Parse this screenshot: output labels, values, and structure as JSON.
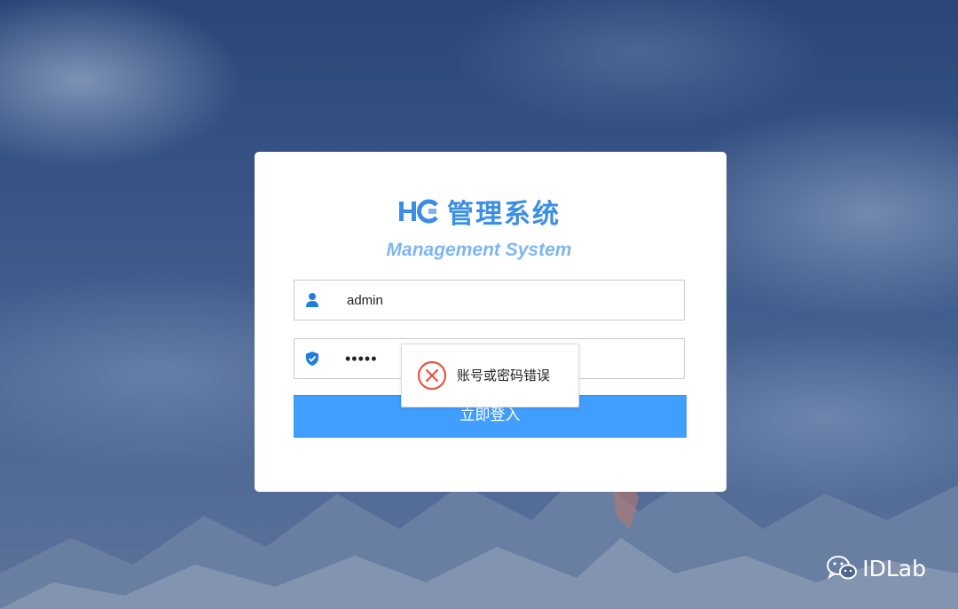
{
  "brand": {
    "title": "HC 管理系统",
    "logo_text": "HC",
    "name": "管理系统",
    "subtitle": "Management System",
    "color": "#3a8ee6"
  },
  "form": {
    "username": {
      "icon": "user-icon",
      "value": "admin"
    },
    "password": {
      "icon": "shield-check-icon",
      "value": "•••••"
    },
    "submit_label": "立即登入",
    "button_color": "#409eff"
  },
  "toast": {
    "icon": "error-circle-x-icon",
    "message": "账号或密码错误",
    "icon_color": "#e5533d"
  },
  "watermark": {
    "icon": "wechat-icon",
    "text": "IDLab"
  }
}
